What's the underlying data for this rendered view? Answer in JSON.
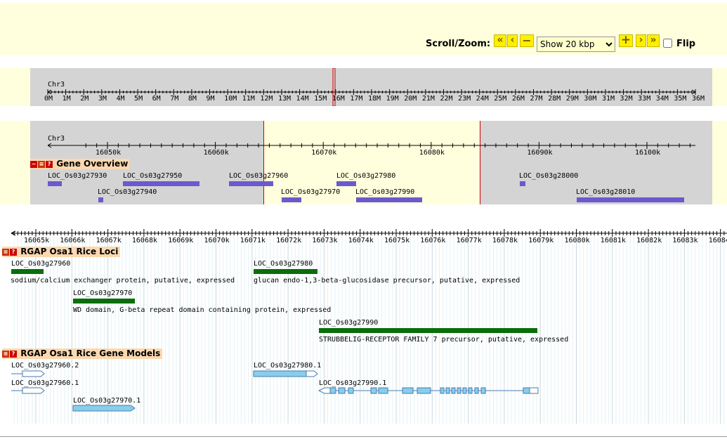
{
  "toolbar": {
    "scroll_zoom_label": "Scroll/Zoom:",
    "buttons": {
      "far_left": "«",
      "left": "‹",
      "zoom_out": "−",
      "zoom_in": "+",
      "right": "›",
      "far_right": "»"
    },
    "zoom_select": {
      "selected": "Show 20 kbp"
    },
    "flip_label": "Flip",
    "flip_checked": false
  },
  "overview": {
    "chrom": "Chr3",
    "ticks": [
      "0M",
      "1M",
      "2M",
      "3M",
      "4M",
      "5M",
      "6M",
      "7M",
      "8M",
      "9M",
      "10M",
      "11M",
      "12M",
      "13M",
      "14M",
      "15M",
      "16M",
      "17M",
      "18M",
      "19M",
      "20M",
      "21M",
      "22M",
      "23M",
      "24M",
      "25M",
      "26M",
      "27M",
      "28M",
      "29M",
      "30M",
      "31M",
      "32M",
      "33M",
      "34M",
      "35M",
      "36M"
    ]
  },
  "region": {
    "chrom": "Chr3",
    "ticks": [
      "16050k",
      "16060k",
      "16070k",
      "16080k",
      "16090k",
      "16100k"
    ],
    "track_title": "Gene Overview",
    "genes": [
      "LOC_Os03g27930",
      "LOC_Os03g27950",
      "LOC_Os03g27960",
      "LOC_Os03g27980",
      "LOC_Os03g28000",
      "LOC_Os03g27940",
      "LOC_Os03g27970",
      "LOC_Os03g27990",
      "LOC_Os03g28010"
    ]
  },
  "detail": {
    "ticks": [
      "16065k",
      "16066k",
      "16067k",
      "16068k",
      "16069k",
      "16070k",
      "16071k",
      "16072k",
      "16073k",
      "16074k",
      "16075k",
      "16076k",
      "16077k",
      "16078k",
      "16079k",
      "16080k",
      "16081k",
      "16082k",
      "16083k",
      "16084"
    ],
    "loci_track": {
      "title": "RGAP Osa1 Rice Loci",
      "items": [
        {
          "name": "LOC_Os03g27960",
          "desc": "sodium/calcium exchanger protein, putative, expressed"
        },
        {
          "name": "LOC_Os03g27980",
          "desc": "glucan endo-1,3-beta-glucosidase precursor, putative, expressed"
        },
        {
          "name": "LOC_Os03g27970",
          "desc": "WD domain, G-beta repeat domain containing protein, expressed"
        },
        {
          "name": "LOC_Os03g27990",
          "desc": "STRUBBELIG-RECEPTOR FAMILY 7 precursor, putative, expressed"
        }
      ]
    },
    "models_track": {
      "title": "RGAP Osa1 Rice Gene Models",
      "items": [
        "LOC_Os03g27960.2",
        "LOC_Os03g27980.1",
        "LOC_Os03g27960.1",
        "LOC_Os03g27990.1",
        "LOC_Os03g27970.1"
      ]
    }
  },
  "colors": {
    "band": "#ffffdd",
    "panel": "#d4d4d4",
    "gene": "#6a5acd",
    "locus": "#0a6e0a",
    "model": "#87ceeb",
    "track_header": "#fbd8b0",
    "marker": "#cc0000"
  }
}
